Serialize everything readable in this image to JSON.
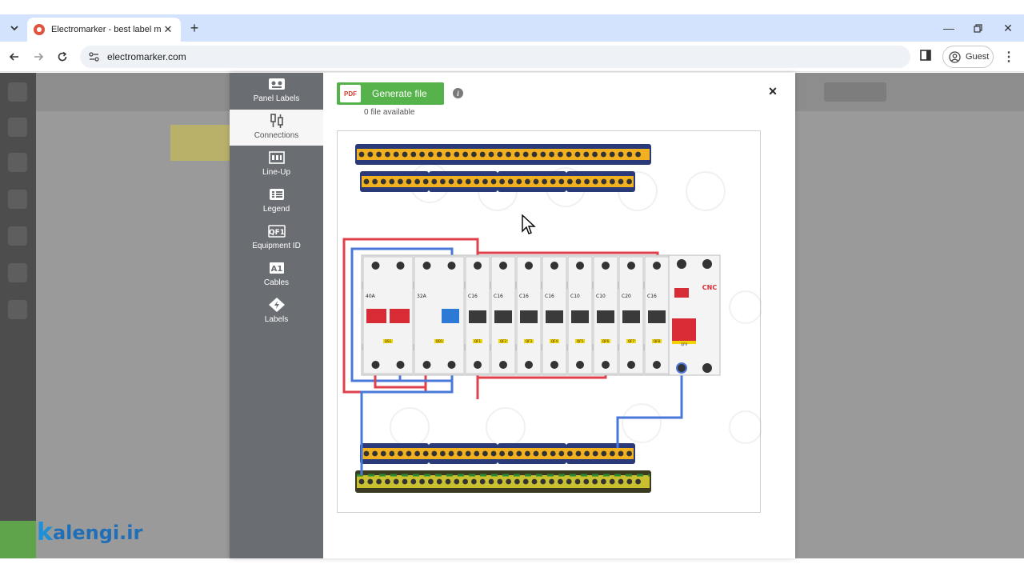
{
  "browser": {
    "tab_title": "Electromarker - best label make",
    "url": "electromarker.com",
    "profile_label": "Guest"
  },
  "modal": {
    "sidebar": [
      {
        "label": "Panel Labels",
        "icon": "panel-labels-icon",
        "active": false
      },
      {
        "label": "Connections",
        "icon": "connections-icon",
        "active": true
      },
      {
        "label": "Line-Up",
        "icon": "line-up-icon",
        "active": false
      },
      {
        "label": "Legend",
        "icon": "legend-icon",
        "active": false
      },
      {
        "label": "Equipment ID",
        "icon": "equipment-id-icon",
        "active": false
      },
      {
        "label": "Cables",
        "icon": "cables-icon",
        "active": false
      },
      {
        "label": "Labels",
        "icon": "labels-icon",
        "active": false
      }
    ],
    "generate_button": "Generate file",
    "pdf_badge": "PDF",
    "files_available": "0 file available",
    "diagram": {
      "breaker_ratings": [
        "40A",
        "32A",
        "C16",
        "C16",
        "C16",
        "C16",
        "C10",
        "C10",
        "C20",
        "C16"
      ],
      "breaker_ids": [
        "QS1",
        "QD1",
        "QF1",
        "QF2",
        "QF3",
        "QF4",
        "QF5",
        "QF6",
        "QF7",
        "QF8"
      ],
      "brand": "CNC",
      "brand_id": "QF9",
      "colors": {
        "phase_wire": "#e0404a",
        "neutral_wire": "#4a78d8",
        "terminal_yellow": "#f0b020",
        "breaker_red": "#d72c35"
      }
    }
  },
  "watermark": {
    "logo_k": "k",
    "logo_text": "alengi.ir"
  }
}
